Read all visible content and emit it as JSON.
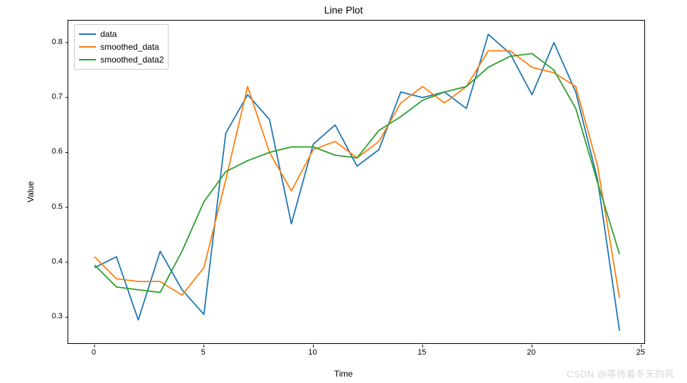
{
  "chart_data": {
    "type": "line",
    "title": "Line Plot",
    "xlabel": "Time",
    "ylabel": "Value",
    "xlim": [
      -1.2,
      25.2
    ],
    "ylim": [
      0.25,
      0.84
    ],
    "xticks": [
      0,
      5,
      10,
      15,
      20,
      25
    ],
    "yticks": [
      0.3,
      0.4,
      0.5,
      0.6,
      0.7,
      0.8
    ],
    "x": [
      0,
      1,
      2,
      3,
      4,
      5,
      6,
      7,
      8,
      9,
      10,
      11,
      12,
      13,
      14,
      15,
      16,
      17,
      18,
      19,
      20,
      21,
      22,
      23,
      24
    ],
    "series": [
      {
        "name": "data",
        "color": "#1f77b4",
        "values": [
          0.39,
          0.41,
          0.295,
          0.42,
          0.35,
          0.305,
          0.635,
          0.705,
          0.66,
          0.47,
          0.615,
          0.65,
          0.575,
          0.605,
          0.71,
          0.7,
          0.71,
          0.68,
          0.815,
          0.78,
          0.705,
          0.8,
          0.71,
          0.55,
          0.275
        ]
      },
      {
        "name": "smoothed_data",
        "color": "#ff7f0e",
        "values": [
          0.41,
          0.37,
          0.365,
          0.365,
          0.34,
          0.39,
          0.55,
          0.72,
          0.6,
          0.53,
          0.605,
          0.62,
          0.59,
          0.62,
          0.69,
          0.72,
          0.69,
          0.72,
          0.785,
          0.785,
          0.755,
          0.745,
          0.72,
          0.575,
          0.335
        ]
      },
      {
        "name": "smoothed_data2",
        "color": "#2ca02c",
        "values": [
          0.395,
          0.355,
          0.35,
          0.345,
          0.42,
          0.51,
          0.565,
          0.585,
          0.6,
          0.61,
          0.61,
          0.595,
          0.59,
          0.64,
          0.665,
          0.695,
          0.71,
          0.72,
          0.755,
          0.775,
          0.78,
          0.75,
          0.68,
          0.545,
          0.415
        ]
      }
    ]
  },
  "watermark": "CSDN @等待着冬天的风"
}
